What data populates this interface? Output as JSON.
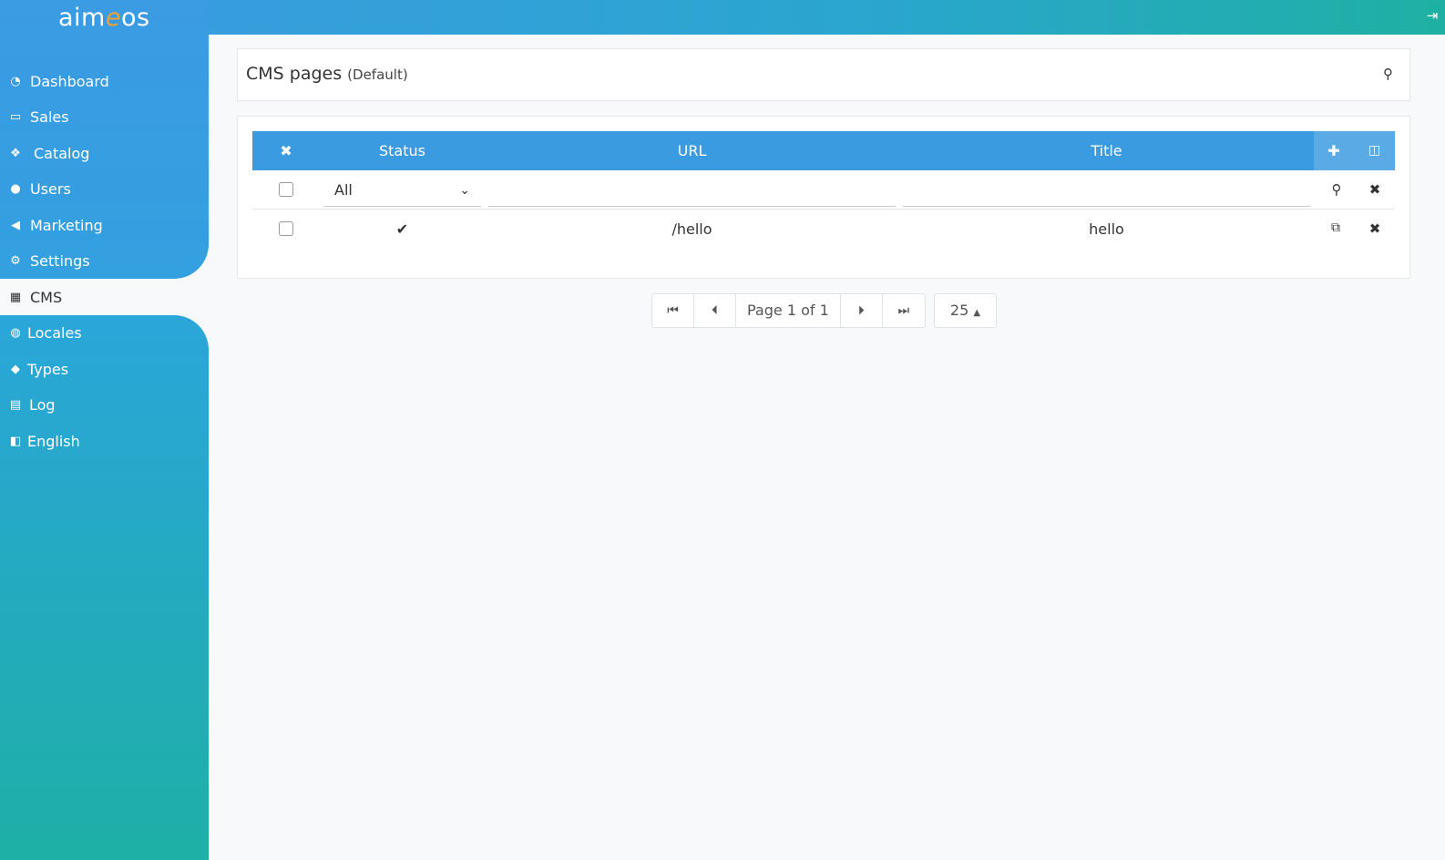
{
  "app": {
    "logo_prefix": "aim",
    "logo_e": "e",
    "logo_suffix": "os"
  },
  "sidebar": {
    "items": [
      {
        "label": "Dashboard",
        "icon": "tachometer-icon"
      },
      {
        "label": "Sales",
        "icon": "money-icon"
      },
      {
        "label": "Catalog",
        "icon": "cubes-icon"
      },
      {
        "label": "Users",
        "icon": "users-icon"
      },
      {
        "label": "Marketing",
        "icon": "bullhorn-icon"
      },
      {
        "label": "Settings",
        "icon": "cogs-icon"
      },
      {
        "label": "CMS",
        "icon": "grid-icon"
      },
      {
        "label": "Locales",
        "icon": "globe-icon"
      },
      {
        "label": "Types",
        "icon": "tag-icon"
      },
      {
        "label": "Log",
        "icon": "archive-icon"
      },
      {
        "label": "English",
        "icon": "language-icon"
      }
    ],
    "active": "CMS"
  },
  "header": {
    "title": "CMS pages",
    "subtitle": "(Default)"
  },
  "table": {
    "columns": [
      "Status",
      "URL",
      "Title"
    ],
    "filter": {
      "status_selected": "All"
    },
    "rows": [
      {
        "status": "✔",
        "url": "/hello",
        "title": "hello"
      }
    ]
  },
  "pagination": {
    "page_text": "Page 1 of 1",
    "per_page": "25"
  },
  "colors": {
    "accent": "#3b9be0",
    "sidebar_gradient_end": "#1eafa6"
  }
}
